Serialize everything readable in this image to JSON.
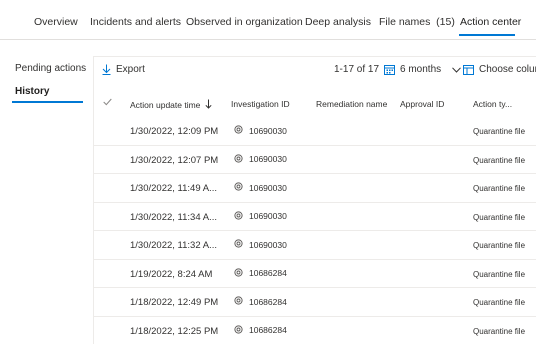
{
  "top_tabs": [
    {
      "label": "Overview"
    },
    {
      "label": "Incidents and alerts"
    },
    {
      "label": "Observed in organization"
    },
    {
      "label": "Deep analysis"
    },
    {
      "label": "File names  (15)"
    },
    {
      "label": "Action center"
    }
  ],
  "left_nav": [
    {
      "label": "Pending actions"
    },
    {
      "label": "History"
    }
  ],
  "toolbar": {
    "export_label": "Export",
    "count_label": "1-17 of 17",
    "range_label": "6 months",
    "columns_label": "Choose columns"
  },
  "columns": {
    "time": "Action update time",
    "investigation": "Investigation ID",
    "remediation": "Remediation name",
    "approval": "Approval ID",
    "type": "Action ty..."
  },
  "rows": [
    {
      "time": "1/30/2022, 12:09 PM",
      "investigation": "10690030",
      "type": "Quarantine file"
    },
    {
      "time": "1/30/2022, 12:07 PM",
      "investigation": "10690030",
      "type": "Quarantine file"
    },
    {
      "time": "1/30/2022, 11:49 A...",
      "investigation": "10690030",
      "type": "Quarantine file"
    },
    {
      "time": "1/30/2022, 11:34 A...",
      "investigation": "10690030",
      "type": "Quarantine file"
    },
    {
      "time": "1/30/2022, 11:32 A...",
      "investigation": "10690030",
      "type": "Quarantine file"
    },
    {
      "time": "1/19/2022, 8:24 AM",
      "investigation": "10686284",
      "type": "Quarantine file"
    },
    {
      "time": "1/18/2022, 12:49 PM",
      "investigation": "10686284",
      "type": "Quarantine file"
    },
    {
      "time": "1/18/2022, 12:25 PM",
      "investigation": "10686284",
      "type": "Quarantine file"
    }
  ],
  "icons": {
    "export": "download-arrow-icon",
    "range": "calendar-icon",
    "chevron": "chevron-down-icon",
    "columns": "columns-icon",
    "select_all": "checkmark-icon",
    "sort": "sort-down-arrow-icon",
    "investigation": "investigation-gear-icon"
  },
  "colors": {
    "accent": "#0078d4",
    "text": "#323130",
    "divider": "#edebe9"
  }
}
